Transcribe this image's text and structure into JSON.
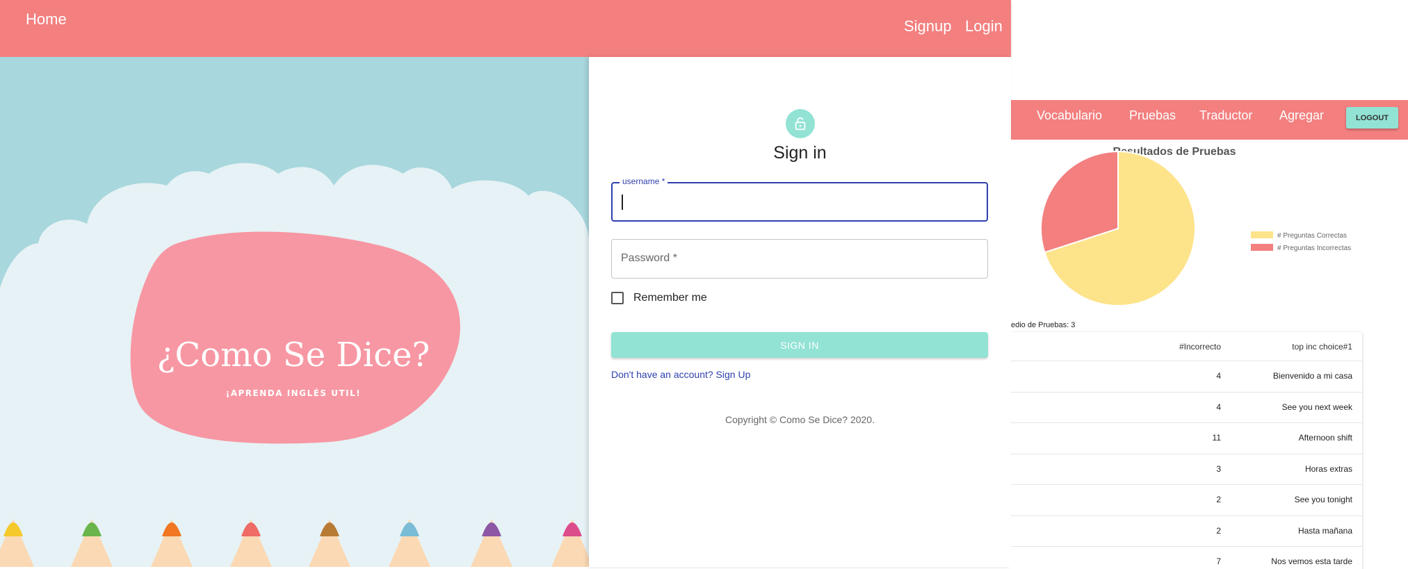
{
  "topbar": {
    "home": "Home",
    "signup": "Signup",
    "login": "Login"
  },
  "hero": {
    "title": "¿Como Se Dice?",
    "subtitle": "¡APRENDA INGLÉS UTIL!"
  },
  "signin": {
    "title": "Sign in",
    "username_label": "username *",
    "password_placeholder": "Password *",
    "remember_label": "Remember me",
    "button": "SIGN IN",
    "signup_link": "Don't have an account? Sign Up",
    "copyright": "Copyright © Como Se Dice? 2020."
  },
  "dashboard": {
    "nav": [
      "Vocabulario",
      "Pruebas",
      "Traductor",
      "Agregar"
    ],
    "logout": "LOGOUT",
    "summary": "edio de Pruebas: 3",
    "table": {
      "headers": [
        "#Incorrecto",
        "top inc choice#1"
      ],
      "rows": [
        {
          "incorrect": "4",
          "choice": "Bienvenido a mi casa"
        },
        {
          "incorrect": "4",
          "choice": "See you next week"
        },
        {
          "incorrect": "11",
          "choice": "Afternoon shift"
        },
        {
          "incorrect": "3",
          "choice": "Horas extras"
        },
        {
          "incorrect": "2",
          "choice": "See you tonight"
        },
        {
          "incorrect": "2",
          "choice": "Hasta mañana"
        },
        {
          "incorrect": "7",
          "choice": "Nos vemos esta tarde"
        }
      ]
    }
  },
  "chart_data": {
    "type": "pie",
    "title": "Resultados de Pruebas",
    "legend_position": "right",
    "series": [
      {
        "name": "# Preguntas Correctas",
        "value": 70,
        "color": "#fde38a"
      },
      {
        "name": "# Preguntas Incorrectas",
        "value": 30,
        "color": "#f37f7f"
      }
    ]
  },
  "colors": {
    "brand": "#f37f7f",
    "accent": "#92e3d4",
    "hero_bg": "#a8d7dd",
    "blob": "#f797a3"
  }
}
